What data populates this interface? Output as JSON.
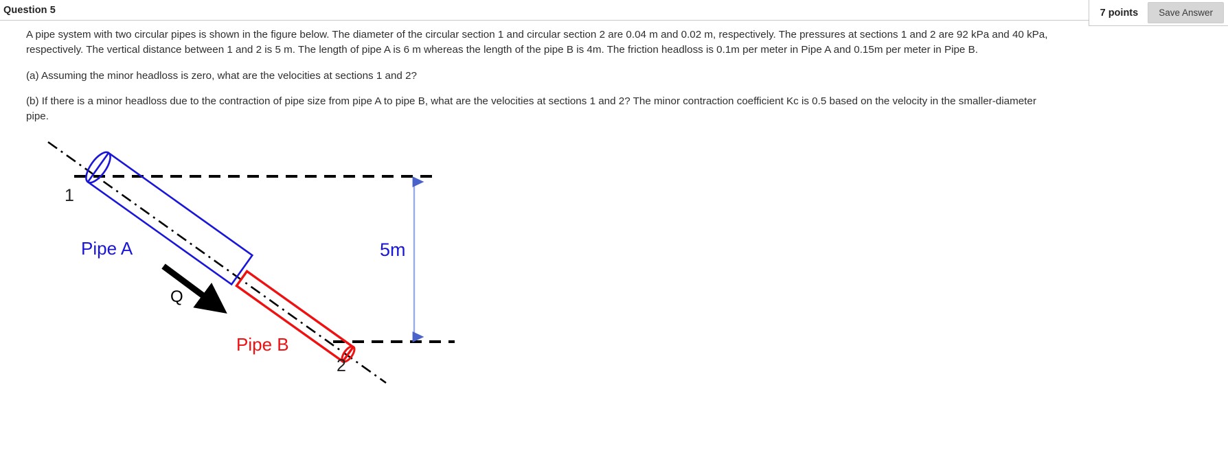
{
  "header": {
    "title": "Question 5",
    "points": "7 points",
    "save_label": "Save Answer"
  },
  "question": {
    "intro": "A pipe system with two circular pipes is shown in the figure below. The diameter of the circular section 1 and circular section 2 are 0.04 m and 0.02 m, respectively. The pressures at sections 1 and 2 are 92 kPa and 40 kPa, respectively. The vertical distance between 1 and 2 is 5 m. The length of pipe A is 6 m whereas the length of the pipe B is 4m. The friction headloss is 0.1m per meter in Pipe A and 0.15m per meter in Pipe B.",
    "part_a": "(a) Assuming the minor headloss is zero, what are the velocities at sections 1 and 2?",
    "part_b": "(b) If there is a minor headloss due to the contraction of pipe size from pipe A to pipe B, what are the velocities at sections 1 and 2? The minor contraction coefficient Kc is 0.5 based on the velocity in the smaller-diameter pipe."
  },
  "figure": {
    "pipe_a_label": "Pipe A",
    "pipe_b_label": "Pipe B",
    "flow_label": "Q",
    "section_1_label": "1",
    "section_2_label": "2",
    "dimension_label": "5m",
    "colors": {
      "pipe_a": "#1a16d8",
      "pipe_b": "#ee1111",
      "centerline": "#000000",
      "datum": "#000000",
      "dimension_line": "#9aa9e8",
      "dimension_arrow": "#4a63c8",
      "dimension_text": "#1a16d8",
      "flow_arrow": "#000000"
    }
  }
}
